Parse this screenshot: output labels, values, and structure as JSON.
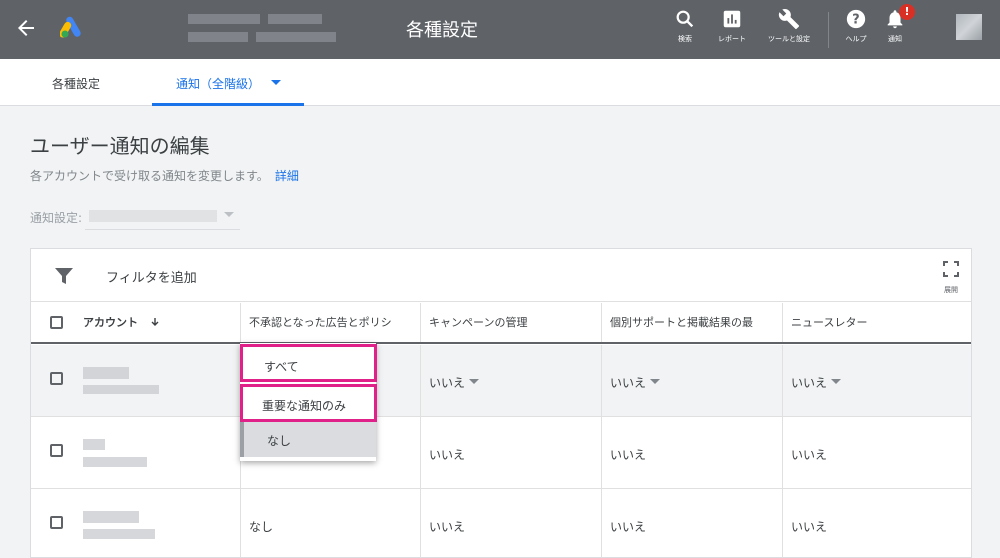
{
  "header": {
    "title": "各種設定",
    "tools": [
      {
        "label": "検索",
        "icon": "search-icon"
      },
      {
        "label": "レポート",
        "icon": "report-icon"
      },
      {
        "label": "ツールと設定",
        "icon": "wrench-icon"
      },
      {
        "label": "ヘルプ",
        "icon": "help-icon"
      },
      {
        "label": "通知",
        "icon": "bell-icon"
      }
    ],
    "notification_badge": "!"
  },
  "tabs": {
    "settings": "各種設定",
    "notifications": "通知（全階級）"
  },
  "page": {
    "heading": "ユーザー通知の編集",
    "description": "各アカウントで受け取る通知を変更します。",
    "details_link": "詳細",
    "notify_setting_label": "通知設定:"
  },
  "table": {
    "filter_label": "フィルタを追加",
    "expand_label": "展開",
    "columns": [
      "アカウント",
      "不承認となった広告とポリシ",
      "キャンペーンの管理",
      "個別サポートと掲載結果の最",
      "ニュースレター"
    ],
    "rows": [
      {
        "col1": "",
        "col2": "いいえ",
        "col3": "いいえ",
        "col4": "いいえ"
      },
      {
        "col1": "",
        "col2": "いいえ",
        "col3": "いいえ",
        "col4": "いいえ"
      },
      {
        "col1": "なし",
        "col2": "いいえ",
        "col3": "いいえ",
        "col4": "いいえ"
      }
    ]
  },
  "dropdown": {
    "options": [
      "すべて",
      "重要な通知のみ",
      "なし"
    ],
    "selected": "なし"
  },
  "colors": {
    "topbar": "#5f6368",
    "accent": "#1a73e8",
    "highlight": "#e0218a",
    "badge": "#d93025"
  }
}
